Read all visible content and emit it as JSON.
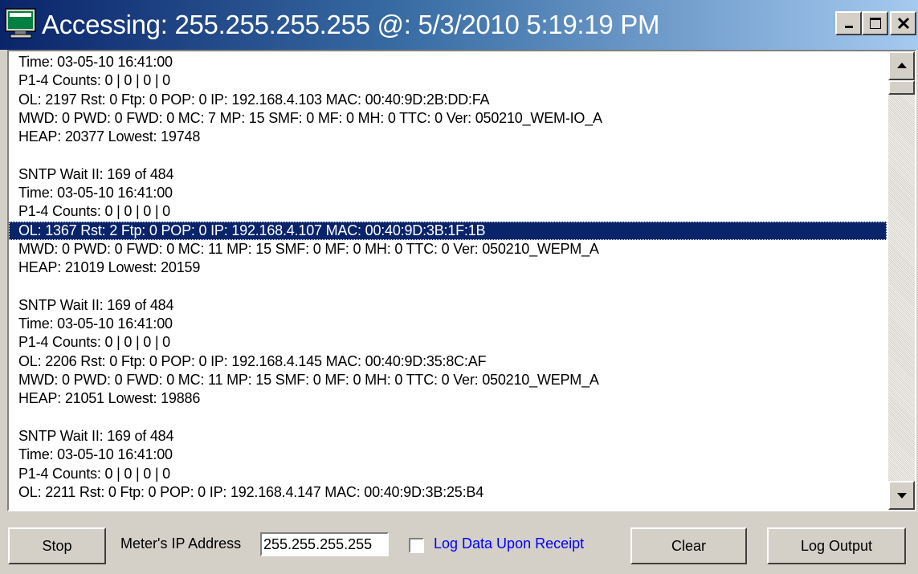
{
  "window": {
    "title": "Accessing: 255.255.255.255 @: 5/3/2010 5:19:19 PM",
    "app_icon": "monitor-icon",
    "controls": [
      "minimize-icon",
      "maximize-icon",
      "close-icon"
    ]
  },
  "log": {
    "selected_index": 9,
    "lines": [
      "Time: 03-05-10 16:41:00",
      "P1-4 Counts: 0 | 0 | 0 | 0",
      "OL: 2197 Rst:  0 Ftp: 0 POP: 0 IP: 192.168.4.103 MAC: 00:40:9D:2B:DD:FA",
      "MWD: 0 PWD: 0 FWD: 0 MC: 7 MP: 15 SMF: 0 MF: 0 MH: 0 TTC: 0 Ver: 050210_WEM-IO_A",
      "HEAP: 20377 Lowest: 19748",
      "",
      "SNTP Wait II: 169 of 484",
      "Time: 03-05-10 16:41:00",
      "P1-4 Counts: 0 | 0 | 0 | 0",
      "OL: 1367 Rst:  2 Ftp: 0 POP: 0 IP: 192.168.4.107 MAC: 00:40:9D:3B:1F:1B",
      "MWD: 0 PWD: 0 FWD: 0 MC: 11 MP: 15 SMF: 0 MF: 0 MH: 0 TTC: 0 Ver: 050210_WEPM_A",
      "HEAP: 21019 Lowest: 20159",
      "",
      "SNTP Wait II: 169 of 484",
      "Time: 03-05-10 16:41:00",
      "P1-4 Counts: 0 | 0 | 0 | 0",
      "OL: 2206 Rst:  0 Ftp: 0 POP: 0 IP: 192.168.4.145 MAC: 00:40:9D:35:8C:AF",
      "MWD: 0 PWD: 0 FWD: 0 MC: 11 MP: 15 SMF: 0 MF: 0 MH: 0 TTC: 0 Ver: 050210_WEPM_A",
      "HEAP: 21051 Lowest: 19886",
      "",
      "SNTP Wait II: 169 of 484",
      "Time: 03-05-10 16:41:00",
      "P1-4 Counts: 0 | 0 | 0 | 0",
      "OL: 2211 Rst:  0 Ftp: 0 POP: 0 IP: 192.168.4.147 MAC: 00:40:9D:3B:25:B4"
    ]
  },
  "controls": {
    "stop_label": "Stop",
    "ip_label": "Meter's IP Address",
    "ip_value": "255.255.255.255",
    "log_checkbox_label": "Log Data Upon Receipt",
    "log_checkbox_checked": false,
    "clear_label": "Clear",
    "log_output_label": "Log Output"
  },
  "colors": {
    "title_gradient_start": "#0a246a",
    "title_gradient_end": "#a6caf0",
    "selection": "#0a246a",
    "checkbox_label": "#0000ff",
    "face": "#d4d0c8"
  }
}
